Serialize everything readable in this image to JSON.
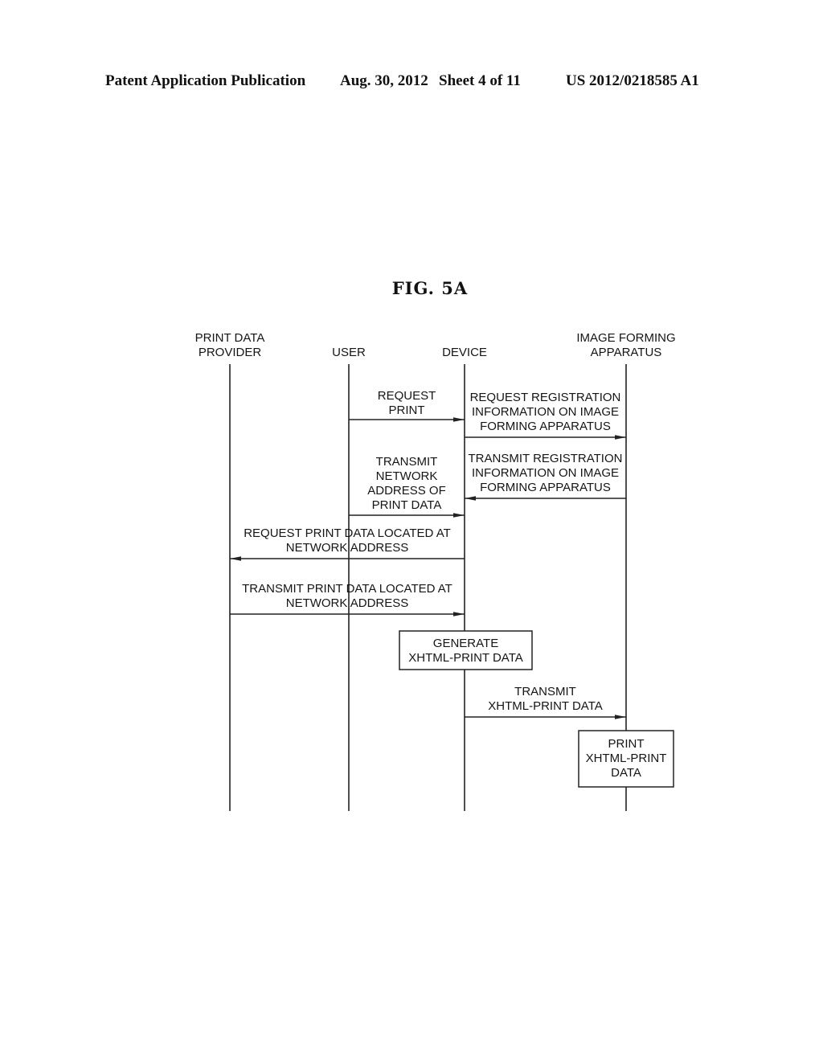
{
  "header": {
    "publication": "Patent Application Publication",
    "date": "Aug. 30, 2012",
    "sheet": "Sheet 4 of 11",
    "number": "US 2012/0218585 A1"
  },
  "figure": {
    "title": "FIG. 5A",
    "participants": [
      {
        "id": "provider",
        "lines": [
          "PRINT DATA",
          "PROVIDER"
        ]
      },
      {
        "id": "user",
        "lines": [
          "USER"
        ]
      },
      {
        "id": "device",
        "lines": [
          "DEVICE"
        ]
      },
      {
        "id": "printer",
        "lines": [
          "IMAGE FORMING",
          "APPARATUS"
        ]
      }
    ],
    "messages": [
      {
        "from": "user",
        "to": "device",
        "lines": [
          "REQUEST",
          "PRINT"
        ]
      },
      {
        "from": "device",
        "to": "printer",
        "lines": [
          "REQUEST REGISTRATION",
          "INFORMATION ON IMAGE",
          "FORMING APPARATUS"
        ]
      },
      {
        "from": "printer",
        "to": "device",
        "lines": [
          "TRANSMIT REGISTRATION",
          "INFORMATION ON IMAGE",
          "FORMING APPARATUS"
        ]
      },
      {
        "from": "user",
        "to": "device",
        "lines": [
          "TRANSMIT",
          "NETWORK",
          "ADDRESS OF",
          "PRINT DATA"
        ]
      },
      {
        "from": "device",
        "to": "provider",
        "lines": [
          "REQUEST PRINT DATA LOCATED AT",
          "NETWORK ADDRESS"
        ]
      },
      {
        "from": "provider",
        "to": "device",
        "lines": [
          "TRANSMIT PRINT DATA LOCATED AT",
          "NETWORK ADDRESS"
        ]
      },
      {
        "from": "device",
        "to": "printer",
        "lines": [
          "TRANSMIT",
          "XHTML-PRINT DATA"
        ]
      }
    ],
    "actions": [
      {
        "on": "device",
        "lines": [
          "GENERATE",
          "XHTML-PRINT DATA"
        ]
      },
      {
        "on": "printer",
        "lines": [
          "PRINT",
          "XHTML-PRINT",
          "DATA"
        ]
      }
    ]
  }
}
